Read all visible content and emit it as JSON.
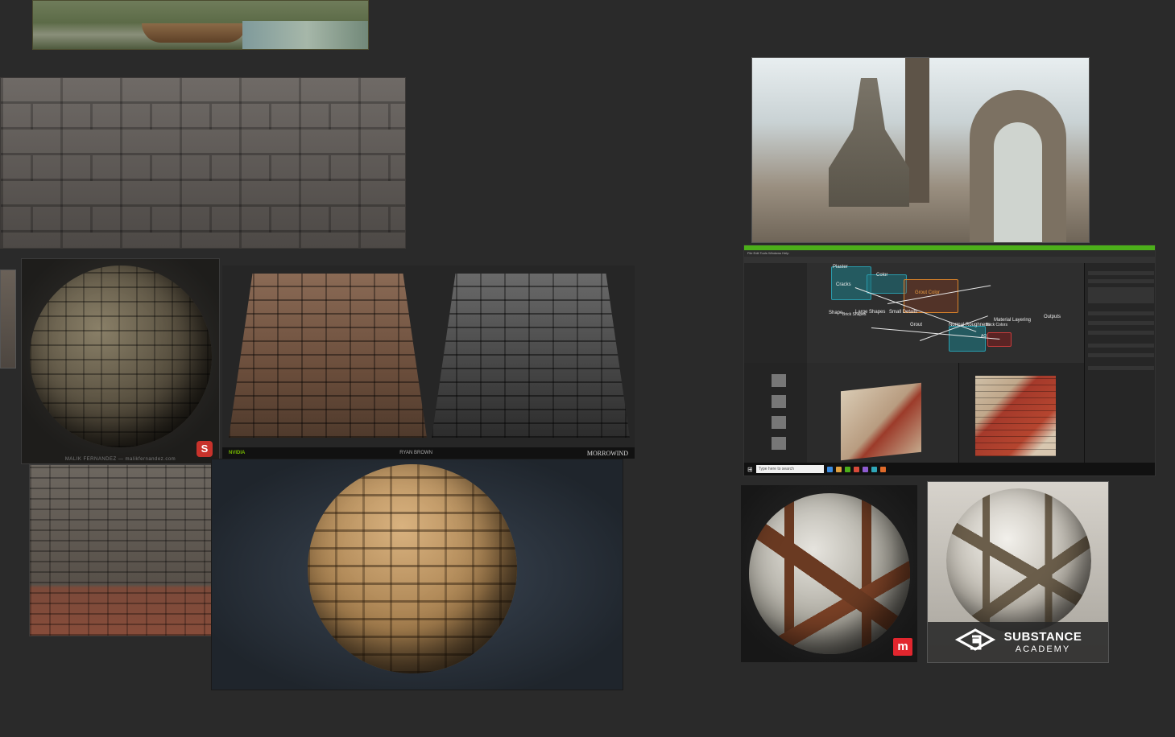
{
  "board": {
    "background": "#2a2a2a",
    "images": [
      {
        "id": "landscape-boat",
        "label": "Landscape with boat"
      },
      {
        "id": "stone-brick-wall",
        "label": "Stone brick wall"
      },
      {
        "id": "stone-sphere",
        "label": "Stone sphere"
      },
      {
        "id": "tile-panels",
        "label": "Stone tile panels"
      },
      {
        "id": "old-brick-wall",
        "label": "Old brick wall"
      },
      {
        "id": "tan-brick-sphere",
        "label": "Tan brick sphere"
      },
      {
        "id": "medieval-town",
        "label": "Medieval town render"
      },
      {
        "id": "substance-designer",
        "label": "Substance Designer screenshot"
      },
      {
        "id": "strap-sphere",
        "label": "Sphere with wooden straps"
      },
      {
        "id": "academy-sphere",
        "label": "Substance Academy sphere"
      }
    ]
  },
  "stone_sphere": {
    "caption": "MALIK FERNANDEZ — malikfernandez.com",
    "badge": "S"
  },
  "tile_panels": {
    "footer_left": "NVIDIA",
    "footer_center": "RYAN BROWN",
    "footer_right": "MORROWIND"
  },
  "designer": {
    "menu": "File  Edit  Tools  Windows  Help",
    "graph_labels": {
      "plaster": "Plaster",
      "color": "Color",
      "cracks": "Cracks",
      "grout_color": "Grout Color",
      "shape": "Shape",
      "brick_shapes": "Brick Shapes",
      "large_shapes": "Large Shapes",
      "small_details": "Small Details",
      "grout": "Grout",
      "normal_roughness": "Normal Roughness",
      "brick_colors": "Brick Colors",
      "material_layering": "Material Layering",
      "outputs": "Outputs",
      "ao": "AO"
    },
    "taskbar_search": "Type here to search",
    "accent": "#4caf1a"
  },
  "strap_sphere": {
    "badge": "m",
    "badge_color": "#e2262e"
  },
  "academy": {
    "brand_line1": "SUBSTANCE",
    "brand_line2": "ACADEMY"
  }
}
